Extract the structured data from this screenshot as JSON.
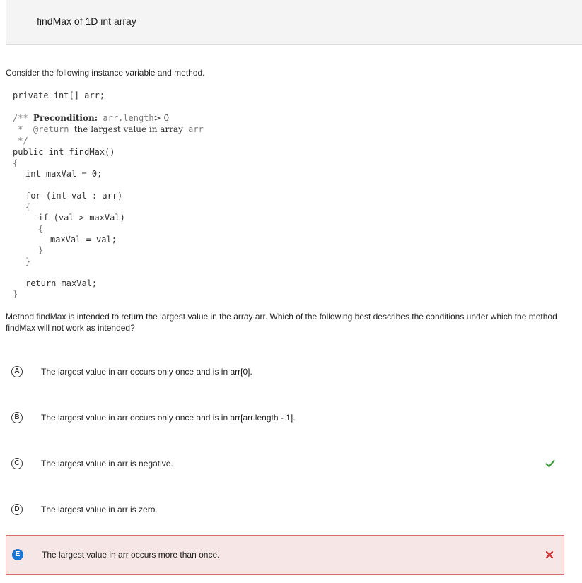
{
  "header": {
    "title": "findMax of 1D int array"
  },
  "intro": "Consider the following instance variable and method.",
  "code": {
    "instance_var": "private int[] arr;",
    "doc_open": "/**",
    "doc_precondition_label": "Precondition:",
    "doc_precondition_expr": "arr.length",
    "doc_precondition_rest": "> 0",
    "doc_star": "*",
    "doc_return_tag": "@return",
    "doc_return_text": "the largest value in array",
    "doc_return_var": "arr",
    "doc_close": "*/",
    "signature": "public int findMax()",
    "brace_open": "{",
    "line_maxval": "int maxVal = 0;",
    "line_for": "for (int val : arr)",
    "for_open": "{",
    "line_if": "if (val > maxVal)",
    "if_open": "{",
    "line_assign": "maxVal = val;",
    "if_close": "}",
    "for_close": "}",
    "line_return": "return maxVal;",
    "brace_close": "}"
  },
  "question": "Method findMax is intended to return the largest value in the array arr. Which of the following best describes the conditions under which the method findMax will not work as intended?",
  "choices": [
    {
      "letter": "A",
      "text": "The largest value in arr occurs only once and is in arr[0].",
      "status": "none"
    },
    {
      "letter": "B",
      "text": "The largest value in arr occurs only once and is in arr[arr.length - 1].",
      "status": "none"
    },
    {
      "letter": "C",
      "text": "The largest value in arr is negative.",
      "status": "correct"
    },
    {
      "letter": "D",
      "text": "The largest value in arr is zero.",
      "status": "none"
    },
    {
      "letter": "E",
      "text": "The largest value in arr occurs more than once.",
      "status": "selected-incorrect"
    }
  ],
  "colors": {
    "correct": "#3a9a3a",
    "incorrect": "#d32f2f",
    "selected_fill": "#f7e6e6",
    "selected_border": "#d96a6a",
    "selected_letter": "#1976d2"
  }
}
